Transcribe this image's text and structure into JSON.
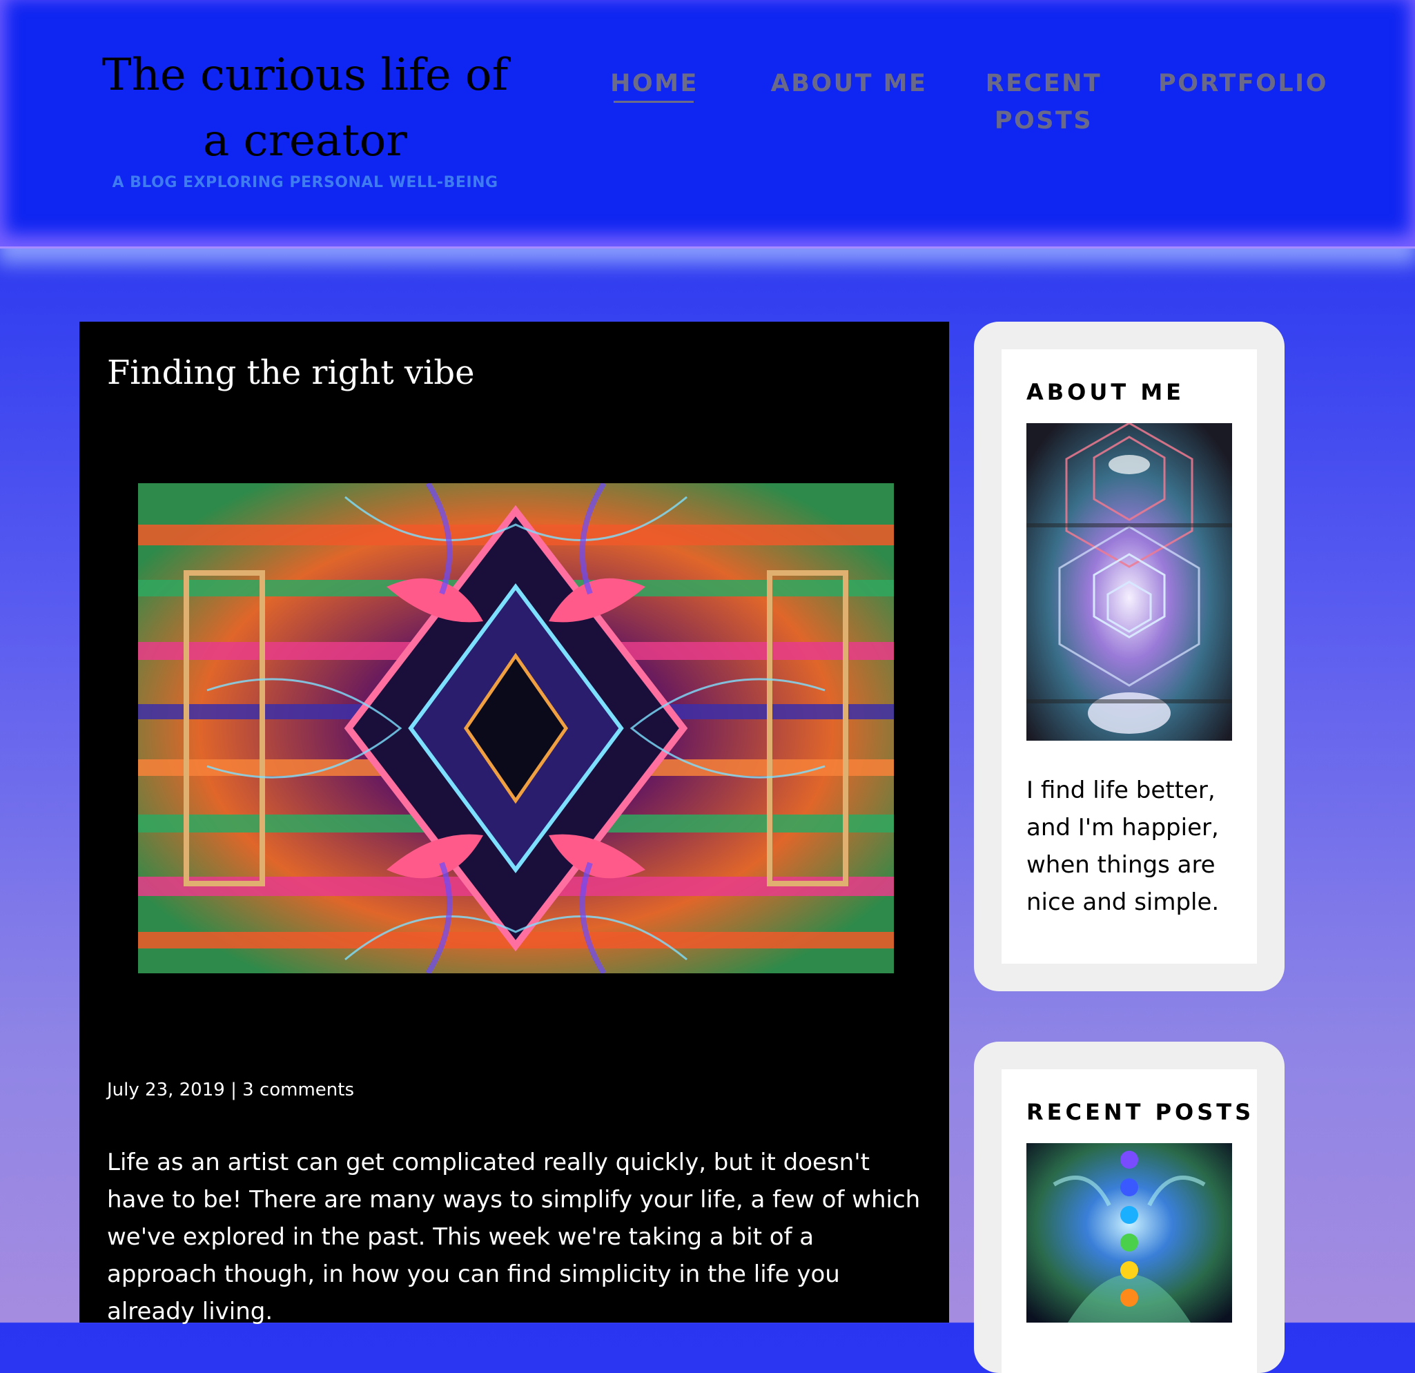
{
  "site": {
    "title": "The curious life of a creator",
    "tagline": "A BLOG EXPLORING PERSONAL WELL-BEING"
  },
  "nav": {
    "items": [
      {
        "label": "HOME",
        "active": true
      },
      {
        "label": "ABOUT ME",
        "active": false
      },
      {
        "label": "RECENT POSTS",
        "active": false
      },
      {
        "label": "PORTFOLIO",
        "active": false
      }
    ]
  },
  "post": {
    "title": "Finding the right vibe",
    "date": "July 23, 2019",
    "separator": " | ",
    "comments": "3 comments",
    "excerpt": "Life as an artist can get complicated really quickly, but it doesn't have to be! There are many ways to simplify your life, a few of which we've explored in the past. This week we're taking a bit of a approach though, in how you can find simplicity in the life you already living."
  },
  "sidebar": {
    "about": {
      "title": "ABOUT ME",
      "text": "I find life better, and I'm happier, when things are nice and simple."
    },
    "recent": {
      "title": "RECENT POSTS"
    }
  },
  "colors": {
    "header_bg": "#0f25f1",
    "tagline": "#3f7cf1",
    "nav_text": "#6a6a88",
    "post_bg": "#000000",
    "widget_frame": "#efefef"
  },
  "icons": [
    "psychedelic-artwork-image",
    "sacred-geometry-image",
    "chakra-meditation-image"
  ]
}
